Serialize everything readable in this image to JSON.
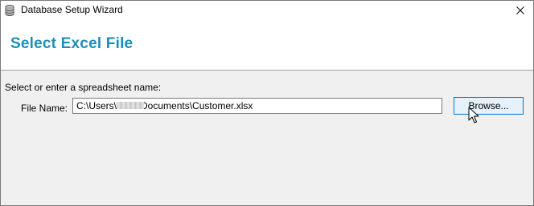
{
  "window": {
    "title": "Database Setup Wizard",
    "app_icon": "database-icon",
    "close_icon": "close-icon"
  },
  "header": {
    "title": "Select Excel File"
  },
  "form": {
    "prompt": "Select or enter a spreadsheet name:",
    "file_name_label": "File Name:",
    "file_name_value": "C:\\Users\\        \\Documents\\Customer.xlsx",
    "browse_label": "Browse..."
  },
  "colors": {
    "title_accent": "#1c8fb8",
    "body_background": "#f0f0f0",
    "button_border_focus": "#0078d7",
    "button_fill_hover": "#e5f1fb"
  }
}
